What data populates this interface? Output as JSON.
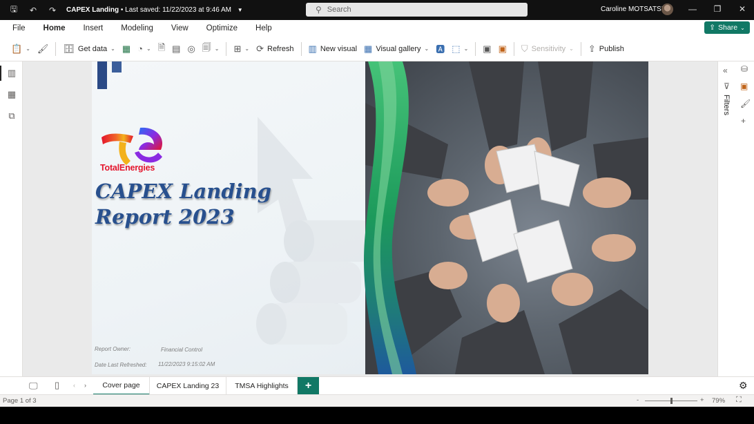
{
  "titlebar": {
    "title": "CAPEX Landing",
    "saved": "•  Last saved: 11/22/2023 at 9:46 AM",
    "search_placeholder": "Search",
    "user": "Caroline MOTSATSI"
  },
  "menu": {
    "items": [
      "File",
      "Home",
      "Insert",
      "Modeling",
      "View",
      "Optimize",
      "Help"
    ],
    "active": "Home",
    "share_label": "Share"
  },
  "ribbon": {
    "get_data": "Get data",
    "refresh": "Refresh",
    "new_visual": "New visual",
    "visual_gallery": "Visual gallery",
    "sensitivity": "Sensitivity",
    "publish": "Publish"
  },
  "report": {
    "brand": "TotalEnergies",
    "headline_line1": "CAPEX Landing",
    "headline_line2": "Report 2023",
    "owner_label": "Report Owner:",
    "owner_value": "Financial Control",
    "refresh_label": "Date Last  Refreshed:",
    "refresh_value": "11/22/2023 9:15:02 AM"
  },
  "rightpane": {
    "filters_label": "Filters"
  },
  "tabs": {
    "pages": [
      "Cover page",
      "CAPEX Landing 23",
      "TMSA Highlights"
    ],
    "active": "Cover page",
    "add_label": "+"
  },
  "status": {
    "page_info": "Page 1 of 3",
    "zoom": "79%",
    "zoom_fraction": 0.5
  },
  "colors": {
    "accent": "#117865",
    "headline": "#28508e",
    "brand_red": "#e4152c"
  }
}
